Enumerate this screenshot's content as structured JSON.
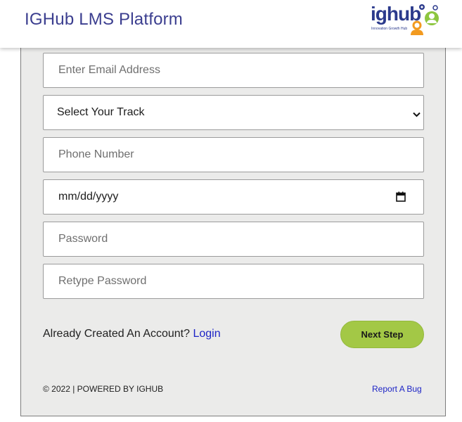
{
  "header": {
    "title": "IGHub LMS Platform",
    "logo": {
      "wordmark": "ighub",
      "tagline": "Innovation Growth Hub",
      "icon": "people-icon"
    }
  },
  "form": {
    "email": {
      "placeholder": "Enter Email Address",
      "value": ""
    },
    "track": {
      "selected": "Select Your Track",
      "icon": "chevron-down-icon"
    },
    "phone": {
      "placeholder": "Phone Number",
      "value": ""
    },
    "dob": {
      "placeholder": "mm/dd/yyyy",
      "icon": "calendar-icon"
    },
    "password": {
      "placeholder": "Password",
      "value": ""
    },
    "retype_password": {
      "placeholder": "Retype Password",
      "value": ""
    }
  },
  "account": {
    "prompt": "Already Created An Account?",
    "login_label": "Login"
  },
  "next_button": {
    "label": "Next Step"
  },
  "footer": {
    "copyright": "© 2022 | POWERED BY IGHUB",
    "report_label": "Report A Bug"
  },
  "colors": {
    "title": "#3b3e8f",
    "panel_bg": "#ebebea",
    "button_bg": "#a3c846",
    "link": "#1d24c6",
    "logo_blue": "#2b3a8c",
    "logo_orange": "#f29a1f",
    "logo_green": "#8dc63f"
  }
}
